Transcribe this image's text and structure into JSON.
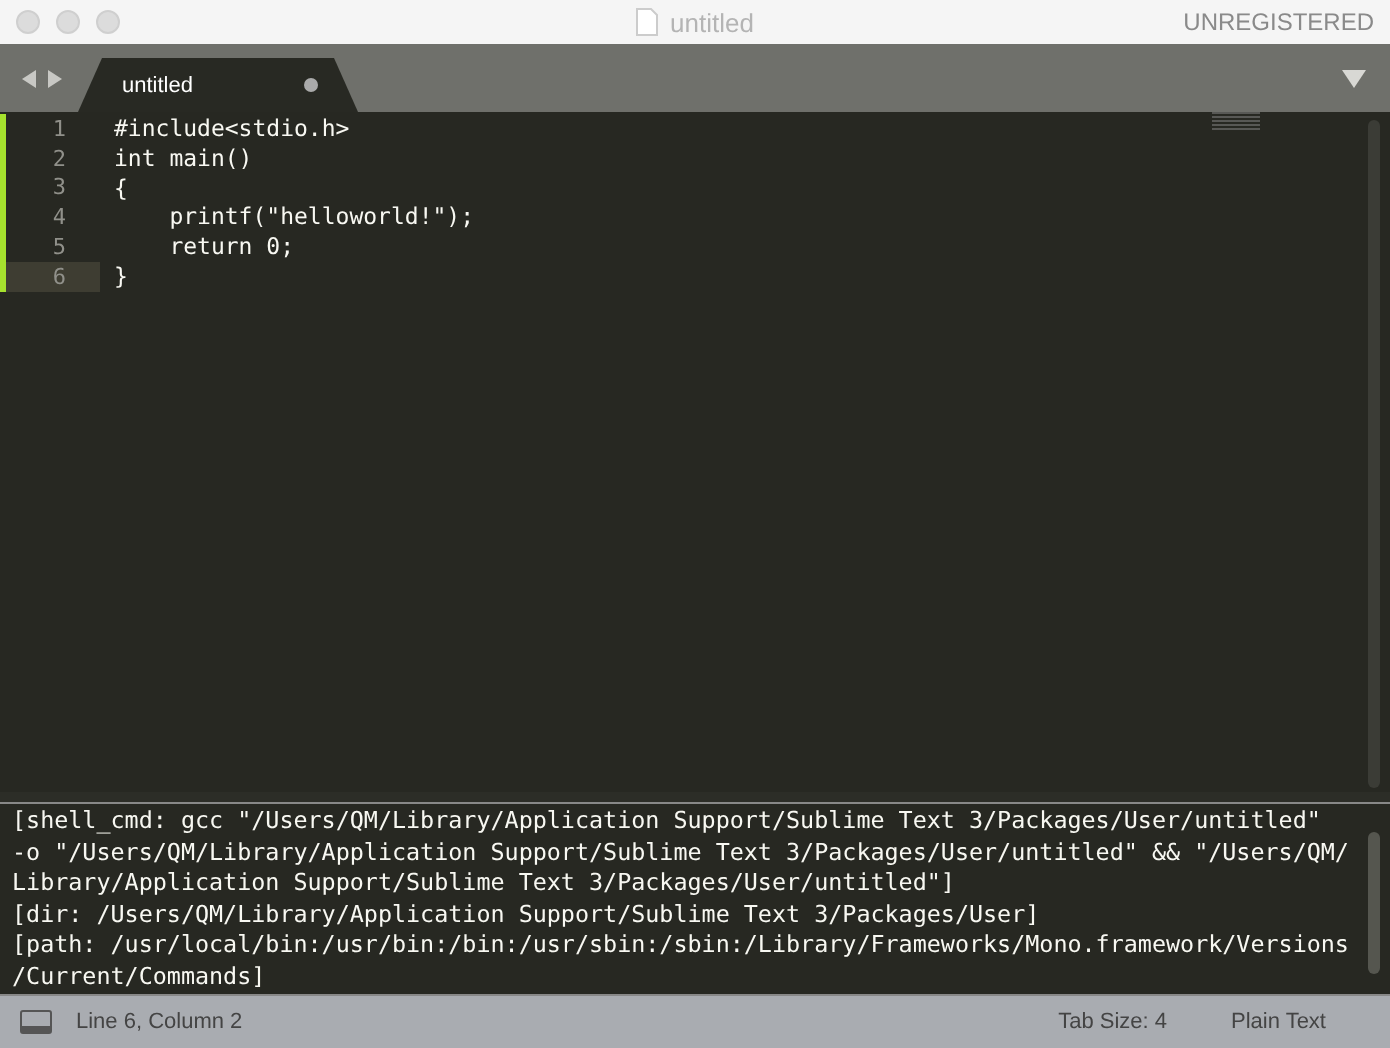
{
  "window": {
    "title": "untitled",
    "badge": "UNREGISTERED"
  },
  "tabs": [
    {
      "label": "untitled",
      "selected": true,
      "dirty": true
    }
  ],
  "editor": {
    "lines": [
      {
        "number": "1",
        "text": "#include<stdio.h>",
        "modified": true,
        "current": false
      },
      {
        "number": "2",
        "text": "int main()",
        "modified": true,
        "current": false
      },
      {
        "number": "3",
        "text": "{",
        "modified": true,
        "current": false
      },
      {
        "number": "4",
        "text": "    printf(\"helloworld!\");",
        "modified": true,
        "current": false
      },
      {
        "number": "5",
        "text": "    return 0;",
        "modified": true,
        "current": false
      },
      {
        "number": "6",
        "text": "}",
        "modified": true,
        "current": true
      }
    ]
  },
  "output_panel": {
    "lines": [
      "[shell_cmd: gcc \"/Users/QM/Library/Application Support/Sublime Text 3/Packages/User/untitled\"",
      "-o \"/Users/QM/Library/Application Support/Sublime Text 3/Packages/User/untitled\" && \"/Users/QM/",
      "Library/Application Support/Sublime Text 3/Packages/User/untitled\"]",
      "[dir: /Users/QM/Library/Application Support/Sublime Text 3/Packages/User]",
      "[path: /usr/local/bin:/usr/bin:/bin:/usr/sbin:/sbin:/Library/Frameworks/Mono.framework/Versions",
      "/Current/Commands]"
    ]
  },
  "status_bar": {
    "position": "Line 6, Column 2",
    "tab_size": "Tab Size: 4",
    "syntax": "Plain Text"
  }
}
